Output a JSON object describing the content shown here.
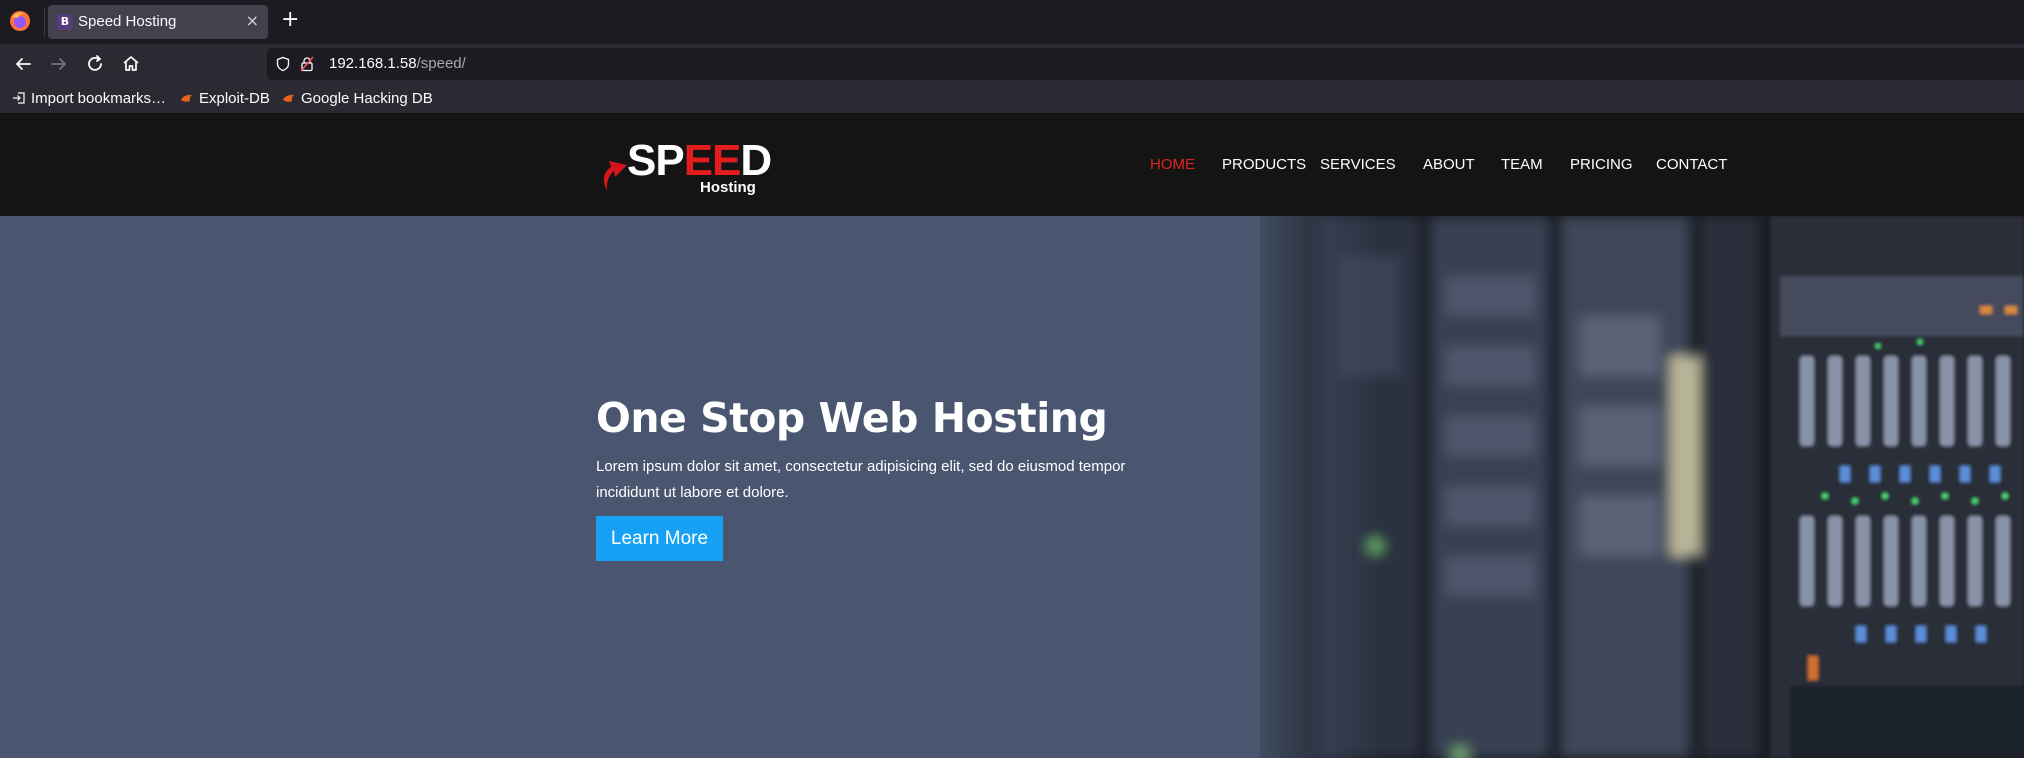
{
  "browser": {
    "tab": {
      "title": "Speed Hosting",
      "favicon_letter": "B",
      "close_glyph": "×"
    },
    "new_tab_glyph": "+",
    "url": {
      "host": "192.168.1.58",
      "path": "/speed/"
    },
    "bookmarks": [
      {
        "label": "Import bookmarks…",
        "icon": "import-icon"
      },
      {
        "label": "Exploit-DB",
        "icon": "exploit-db-icon"
      },
      {
        "label": "Google Hacking DB",
        "icon": "ghdb-icon"
      }
    ]
  },
  "site": {
    "logo": {
      "text_white_1": "SP",
      "text_red": "EE",
      "text_white_2": "D",
      "sub": "Hosting"
    },
    "nav": [
      {
        "label": "HOME",
        "active": true
      },
      {
        "label": "PRODUCTS",
        "active": false
      },
      {
        "label": "SERVICES",
        "active": false
      },
      {
        "label": "ABOUT",
        "active": false
      },
      {
        "label": "TEAM",
        "active": false
      },
      {
        "label": "PRICING",
        "active": false
      },
      {
        "label": "CONTACT",
        "active": false
      }
    ],
    "hero": {
      "title": "One Stop Web Hosting",
      "text": "Lorem ipsum dolor sit amet, consectetur adipisicing elit, sed do eiusmod tempor incididunt ut labore et dolore.",
      "button": "Learn More"
    },
    "colors": {
      "accent_red": "#e0241e",
      "button_blue": "#16a1f4",
      "hero_bg": "#4a566f",
      "header_bg": "#141414"
    }
  }
}
